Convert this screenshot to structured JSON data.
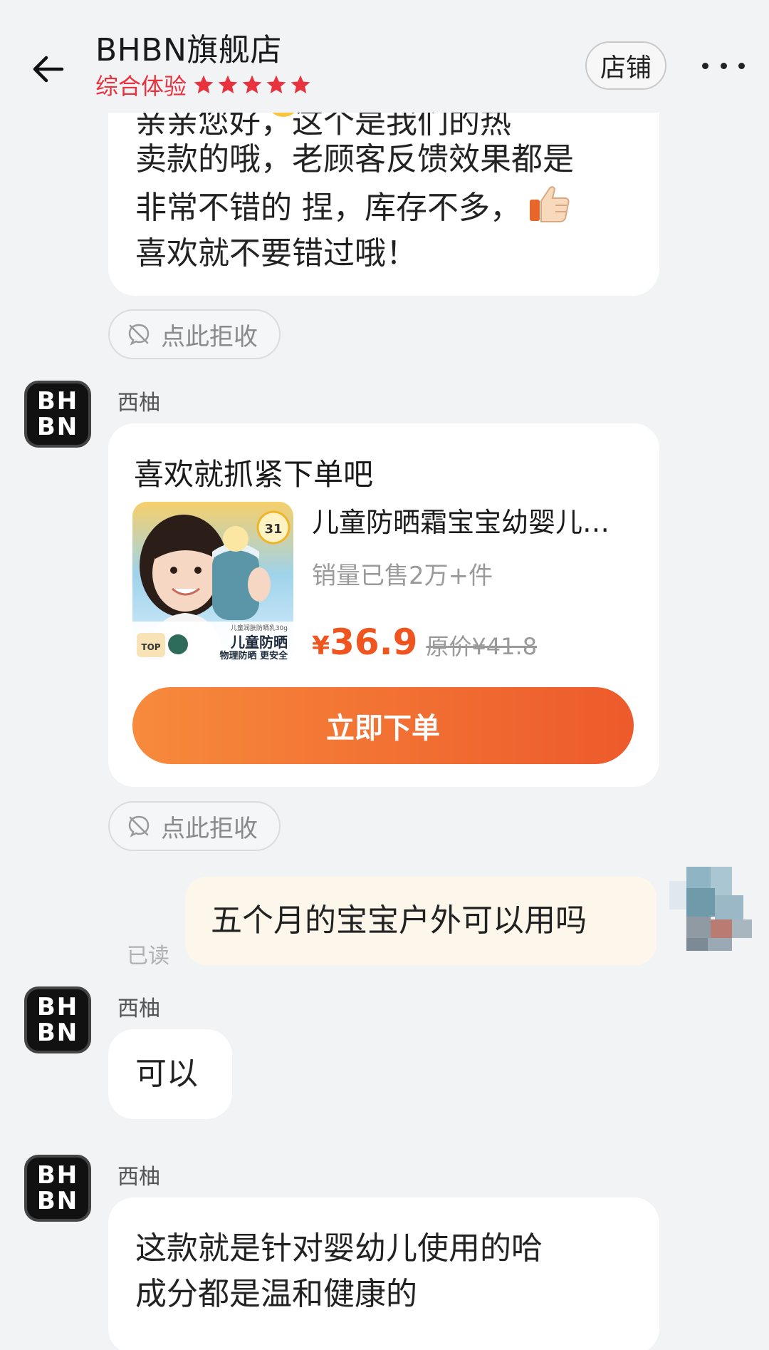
{
  "header": {
    "store_name": "BHBN旗舰店",
    "rating_label": "综合体验",
    "rating_stars": 5,
    "shop_button": "店铺"
  },
  "messages": {
    "top_clipped_line": "亲亲您好，这个是我们的热",
    "top_body_line1": "卖款的哦，老顾客反馈效果都是",
    "top_body_line2": "非常不错的 捏，库存不多，",
    "top_body_line3": "喜欢就不要错过哦！",
    "reject_label": "点此拒收",
    "avatar_text_top": "BH",
    "avatar_text_bottom": "BN",
    "sender_name": "西柚",
    "card_title": "喜欢就抓紧下单吧",
    "product": {
      "name": "儿童防晒霜宝宝幼婴儿…",
      "sales": "销量已售2万+件",
      "currency": "¥",
      "price": "36.9",
      "original_price": "原价¥41.8",
      "buy_button": "立即下单",
      "image_text_main": "儿童防晒",
      "image_text_sub": "物理防晒 更安全",
      "image_text_top": "儿童润肤防晒乳30g",
      "image_badge": "TOP",
      "image_spf": "31"
    },
    "my_message": "五个月的宝宝户外可以用吗",
    "read_status": "已读",
    "reply_1": "可以",
    "reply_2_line1": "这款就是针对婴幼儿使用的哈",
    "reply_2_line2": "成分都是温和健康的"
  },
  "colors": {
    "accent_red": "#e8333e",
    "price_orange": "#f0541f",
    "button_gradient_start": "#f78a3c",
    "button_gradient_end": "#ed5a2b",
    "background": "#f2f3f5",
    "my_bubble": "#fcf7ea"
  },
  "icons": {
    "back": "arrow-left-icon",
    "star": "star-icon",
    "more": "more-dots-icon",
    "reject": "no-message-icon"
  }
}
